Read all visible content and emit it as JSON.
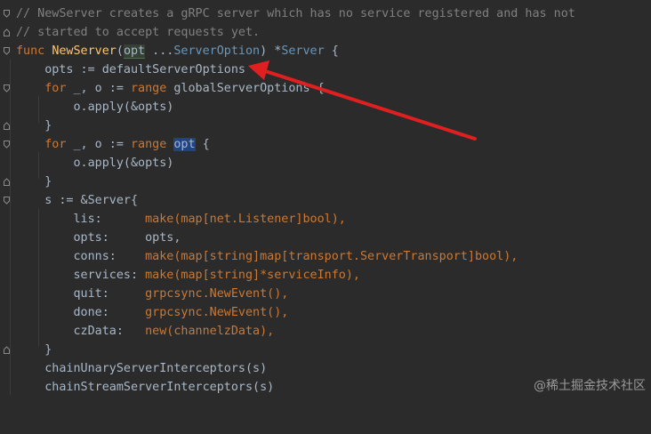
{
  "lines": [
    {
      "kind": "comment",
      "text": "// NewServer creates a gRPC server which has no service registered and has not"
    },
    {
      "kind": "comment",
      "text": "// started to accept requests yet."
    },
    {
      "kind": "sig",
      "kw": "func",
      "name": "NewServer",
      "open": "(",
      "param": "opt",
      "variadic": " ...",
      "ptype": "ServerOption",
      "close": ") *",
      "rtype": "Server",
      "brace": " {"
    },
    {
      "kind": "plain",
      "indent": "    ",
      "text": "opts := defaultServerOptions"
    },
    {
      "kind": "for1",
      "indent": "    ",
      "kw1": "for",
      "mid": " _, o := ",
      "kw2": "range",
      "tail": " globalServerOptions {"
    },
    {
      "kind": "plain",
      "indent": "        ",
      "text": "o.apply(&opts)"
    },
    {
      "kind": "plain",
      "indent": "    ",
      "text": "}"
    },
    {
      "kind": "for2",
      "indent": "    ",
      "kw1": "for",
      "mid": " _, o := ",
      "kw2": "range",
      "sp": " ",
      "param": "opt",
      "tail": " {"
    },
    {
      "kind": "plain",
      "indent": "        ",
      "text": "o.apply(&opts)"
    },
    {
      "kind": "plain",
      "indent": "    ",
      "text": "}"
    },
    {
      "kind": "plain",
      "indent": "    ",
      "text": "s := &Server{"
    },
    {
      "kind": "field",
      "indent": "        ",
      "name": "lis:      ",
      "value": "make(map[net.Listener]bool),"
    },
    {
      "kind": "field",
      "indent": "        ",
      "name": "opts:     ",
      "value": "opts,"
    },
    {
      "kind": "field",
      "indent": "        ",
      "name": "conns:    ",
      "value": "make(map[string]map[transport.ServerTransport]bool),"
    },
    {
      "kind": "field",
      "indent": "        ",
      "name": "services: ",
      "value": "make(map[string]*serviceInfo),"
    },
    {
      "kind": "field",
      "indent": "        ",
      "name": "quit:     ",
      "value": "grpcsync.NewEvent(),"
    },
    {
      "kind": "field",
      "indent": "        ",
      "name": "done:     ",
      "value": "grpcsync.NewEvent(),"
    },
    {
      "kind": "field",
      "indent": "        ",
      "name": "czData:   ",
      "value": "new(channelzData),"
    },
    {
      "kind": "plain",
      "indent": "    ",
      "text": "}"
    },
    {
      "kind": "plain",
      "indent": "    ",
      "text": "chainUnaryServerInterceptors(s)"
    },
    {
      "kind": "plain",
      "indent": "    ",
      "text": "chainStreamServerInterceptors(s)"
    }
  ],
  "watermark": "@稀土掘金技术社区",
  "colors": {
    "background": "#2b2b2b",
    "annotation_arrow": "#e02020"
  }
}
